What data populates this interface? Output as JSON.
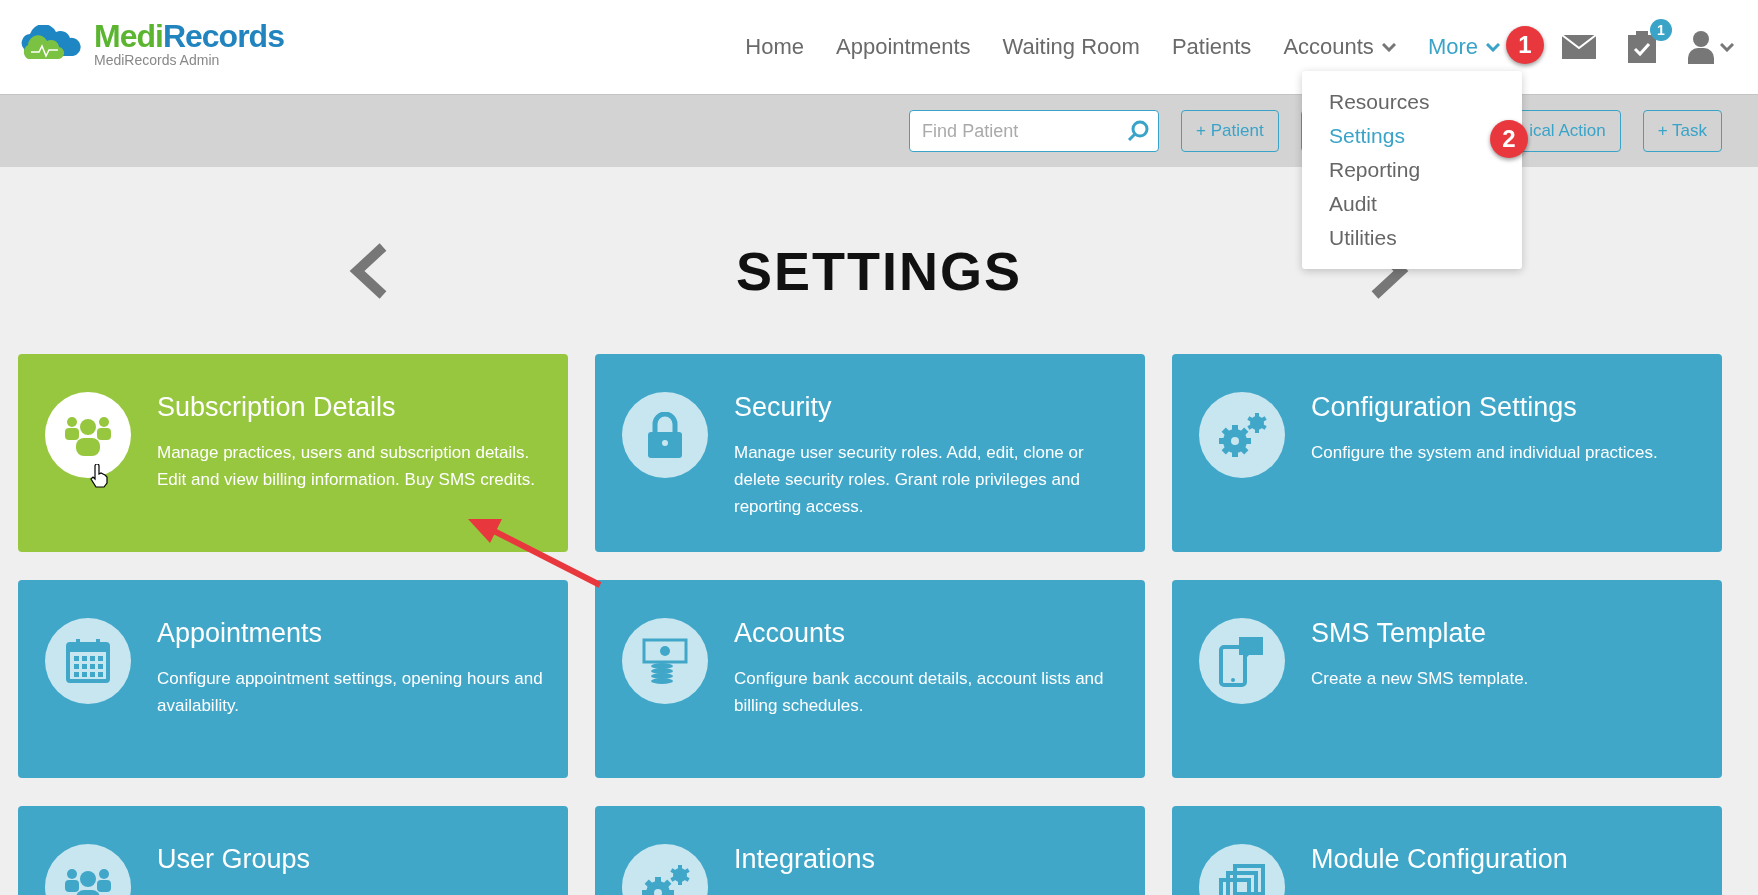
{
  "logo": {
    "brand_first": "Medi",
    "brand_second": "Records",
    "subtitle": "MediRecords Admin"
  },
  "nav": [
    {
      "label": "Home",
      "selected": false,
      "dropdown": false
    },
    {
      "label": "Appointments",
      "selected": false,
      "dropdown": false
    },
    {
      "label": "Waiting Room",
      "selected": false,
      "dropdown": false
    },
    {
      "label": "Patients",
      "selected": false,
      "dropdown": false
    },
    {
      "label": "Accounts",
      "selected": false,
      "dropdown": true
    },
    {
      "label": "More",
      "selected": true,
      "dropdown": true
    }
  ],
  "tasks_badge": "1",
  "toolbar": {
    "search": {
      "placeholder": "Find Patient"
    },
    "buttons": [
      "+ Patient",
      "ical Action",
      "+ Task"
    ]
  },
  "more_menu": [
    {
      "label": "Resources",
      "selected": false
    },
    {
      "label": "Settings",
      "selected": true
    },
    {
      "label": "Reporting",
      "selected": false
    },
    {
      "label": "Audit",
      "selected": false
    },
    {
      "label": "Utilities",
      "selected": false
    }
  ],
  "page_title": "SETTINGS",
  "cards": [
    {
      "kind": "people",
      "title": "Subscription Details",
      "description": "Manage practices, users and subscription details. Edit and view billing information. Buy SMS credits.",
      "selected": true
    },
    {
      "kind": "lock",
      "title": "Security",
      "description": "Manage user security roles. Add, edit, clone or delete security roles. Grant role privileges and reporting access.",
      "selected": false
    },
    {
      "kind": "gears",
      "title": "Configuration Settings",
      "description": "Configure the system and individual practices.",
      "selected": false
    },
    {
      "kind": "calendar",
      "title": "Appointments",
      "description": "Configure appointment settings, opening hours and availability.",
      "selected": false
    },
    {
      "kind": "money",
      "title": "Accounts",
      "description": "Configure bank account details, account lists and billing schedules.",
      "selected": false
    },
    {
      "kind": "phone",
      "title": "SMS Template",
      "description": "Create a new SMS template.",
      "selected": false
    },
    {
      "kind": "people",
      "title": "User Groups",
      "selected": false
    },
    {
      "kind": "gears",
      "title": "Integrations",
      "selected": false
    },
    {
      "kind": "windows",
      "title": "Module Configuration",
      "selected": false
    }
  ],
  "annotations": [
    "1",
    "2"
  ]
}
